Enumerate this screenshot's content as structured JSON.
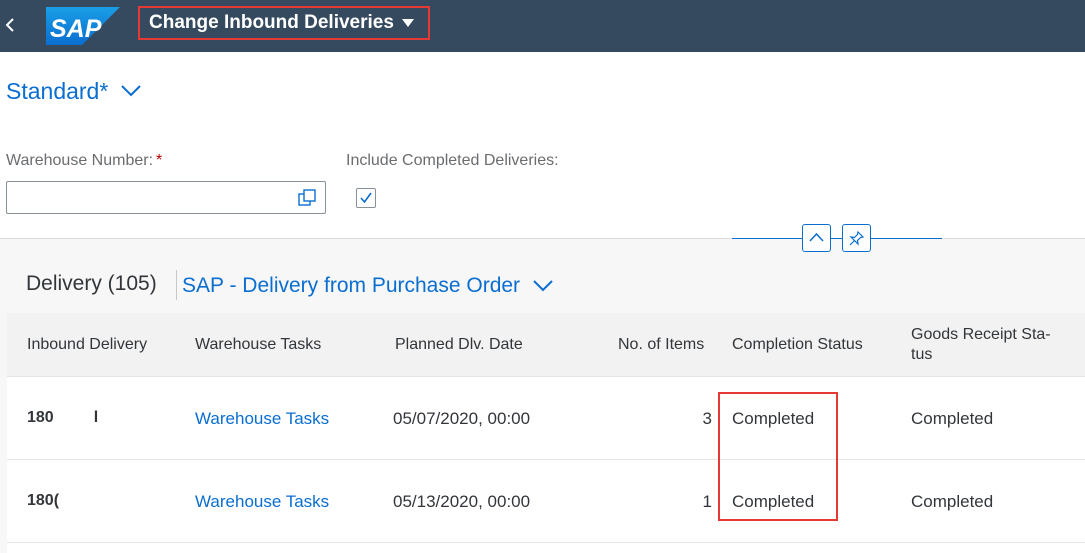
{
  "shell": {
    "logo_text": "SAP",
    "app_title": "Change Inbound Deliveries"
  },
  "variant": {
    "name": "Standard*"
  },
  "filters": {
    "warehouse_label": "Warehouse Number:",
    "warehouse_required_mark": "*",
    "warehouse_value": "",
    "include_completed_label": "Include Completed Deliveries:",
    "include_completed_checked": true
  },
  "table": {
    "title": "Delivery (105)",
    "variant": "SAP - Delivery from Purchase Order",
    "columns": [
      "Inbound Delivery",
      "Warehouse Tasks",
      "Planned Dlv. Date",
      "No. of Items",
      "Completion Status",
      "Goods Receipt Sta-",
      "tus"
    ],
    "rows": [
      {
        "delivery": "180         l",
        "warehouse_tasks": "Warehouse Tasks",
        "planned_date": "05/07/2020, 00:00",
        "items": "3",
        "completion": "Completed",
        "goods_receipt": "Completed"
      },
      {
        "delivery": "180(",
        "warehouse_tasks": "Warehouse Tasks",
        "planned_date": "05/13/2020, 00:00",
        "items": "1",
        "completion": "Completed",
        "goods_receipt": "Completed"
      }
    ]
  },
  "colors": {
    "shell_bg": "#354a5f",
    "link": "#0a6ed1",
    "highlight": "#e53935"
  }
}
